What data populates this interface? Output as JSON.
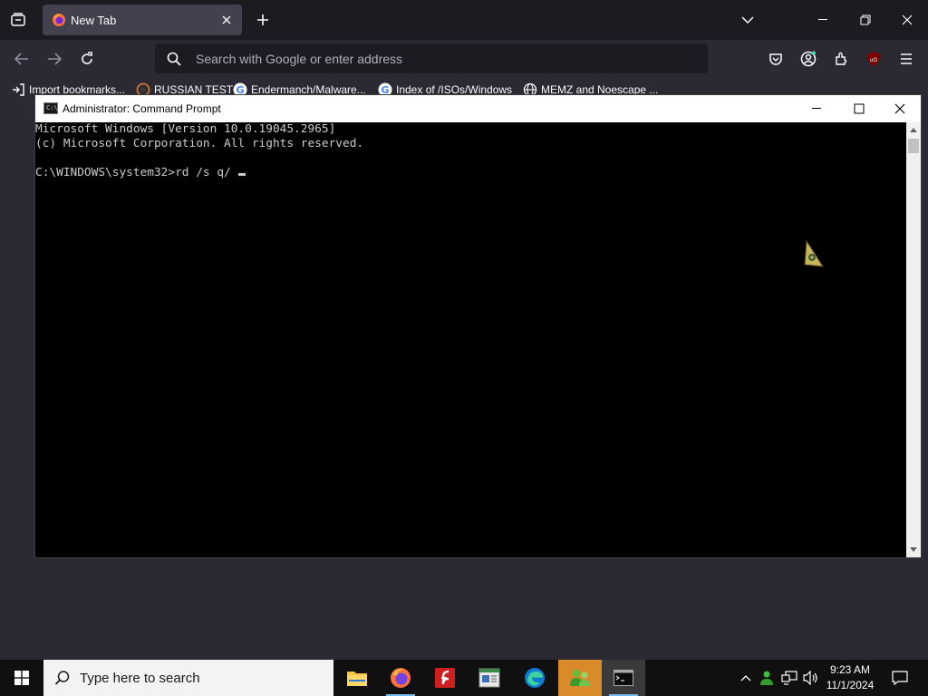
{
  "browser": {
    "tab": {
      "title": "New Tab"
    },
    "urlbar": {
      "placeholder": "Search with Google or enter address"
    },
    "bookmarks": [
      {
        "label": "Import bookmarks...",
        "icon": "import-icon"
      },
      {
        "label": "RUSSIAN TEST",
        "icon": "site-favicon"
      },
      {
        "label": "Endermanch/Malware...",
        "icon": "google-icon"
      },
      {
        "label": "Index of /ISOs/Windows",
        "icon": "google-icon"
      },
      {
        "label": "MEMZ and Noescape ...",
        "icon": "globe-icon"
      }
    ]
  },
  "cmd": {
    "title": "Administrator: Command Prompt",
    "lines": [
      "Microsoft Windows [Version 10.0.19045.2965]",
      "(c) Microsoft Corporation. All rights reserved.",
      "",
      "C:\\WINDOWS\\system32>rd /s q/"
    ]
  },
  "taskbar": {
    "search_placeholder": "Type here to search",
    "time": "9:23 AM",
    "date": "11/1/2024"
  },
  "colors": {
    "browser_bg": "#2b2a33",
    "tabstrip_bg": "#1c1b22",
    "console_text": "#cccccc",
    "taskbar_active": "#d98b2b",
    "ublock_red": "#b31b1b"
  }
}
